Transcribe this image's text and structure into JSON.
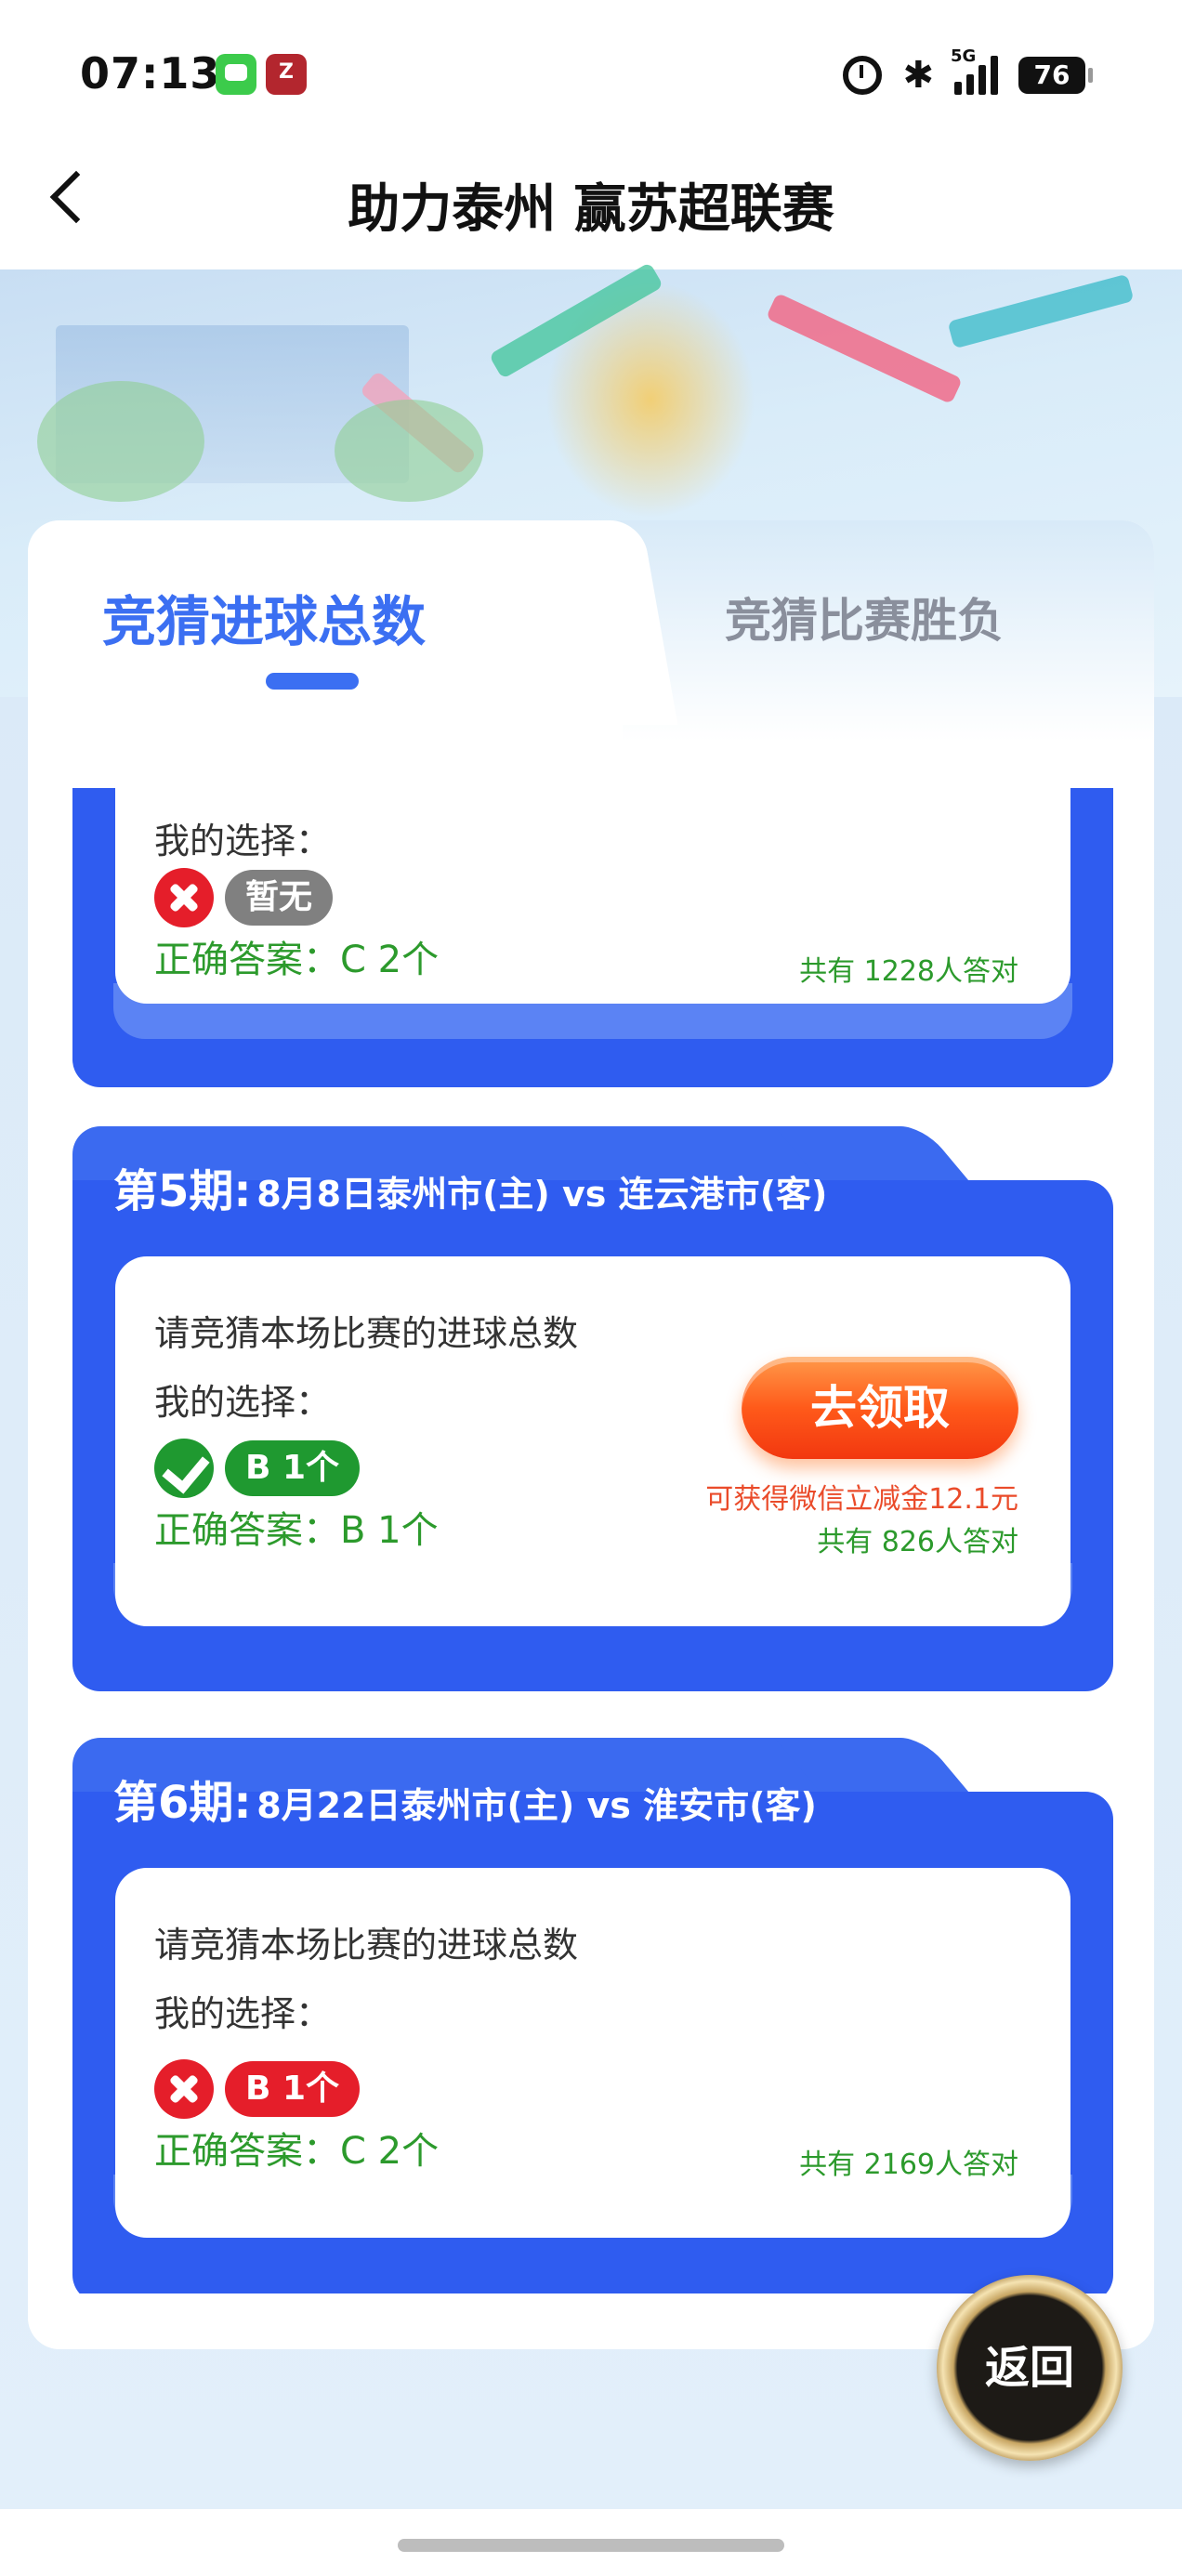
{
  "status_bar": {
    "time": "07:13",
    "app_z_label": "Z",
    "network_label": "5G",
    "battery": "76"
  },
  "nav": {
    "title": "助力泰州 赢苏超联赛"
  },
  "tabs": {
    "active": "竞猜进球总数",
    "inactive": "竞猜比赛胜负"
  },
  "cards": [
    {
      "my_choice_label": "我的选择：",
      "choice_status": "wrong",
      "choice": "暂无",
      "correct_answer": "正确答案：C 2个",
      "correct_count": "共有 1228人答对"
    },
    {
      "period": "第5期:",
      "match": "8月8日泰州市(主) vs 连云港市(客)",
      "question": "请竞猜本场比赛的进球总数",
      "my_choice_label": "我的选择：",
      "choice_status": "correct",
      "choice": "B 1个",
      "correct_answer": "正确答案：B 1个",
      "claim_button": "去领取",
      "bonus_text": "可获得微信立减金12.1元",
      "correct_count": "共有 826人答对"
    },
    {
      "period": "第6期:",
      "match": "8月22日泰州市(主) vs 淮安市(客)",
      "question": "请竞猜本场比赛的进球总数",
      "my_choice_label": "我的选择：",
      "choice_status": "wrong",
      "choice": "B 1个",
      "correct_answer": "正确答案：C 2个",
      "correct_count": "共有 2169人答对"
    }
  ],
  "return_button": "返回",
  "colors": {
    "primary_blue": "#3b6ff2",
    "card_blue": "#2f5cf0",
    "correct_green": "#1f9930",
    "wrong_red": "#e51e2a",
    "claim_orange": "#ff5a1a"
  }
}
